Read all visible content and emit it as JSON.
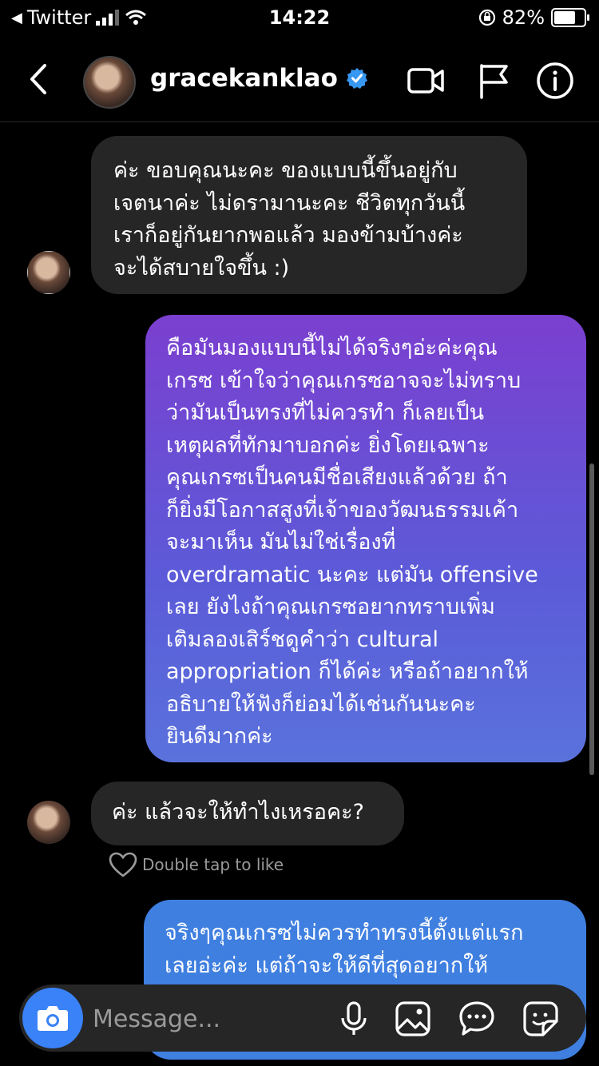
{
  "status_bar": {
    "carrier": "Twitter",
    "time": "14:22",
    "battery_percent": "82%",
    "battery_level": 0.82
  },
  "header": {
    "username": "gracekanklao",
    "verified": true,
    "icons": [
      "back-arrow-icon",
      "video-call-icon",
      "flag-icon",
      "info-icon"
    ]
  },
  "messages": [
    {
      "sender": "them",
      "lines": [
        "ค่ะ ขอบคุณนะคะ ของแบบนี้ขึ้นอยู่กับ",
        "เจตนาค่ะ ไม่ดรามานะคะ ชีวิตทุกวันนี้",
        "เราก็อยู่กันยากพอแล้ว มองข้ามบ้างค่ะ",
        "จะได้สบายใจขึ้น :)"
      ]
    },
    {
      "sender": "me",
      "lines": [
        "คือมันมองแบบนี้ไม่ได้จริงๆอ่ะค่ะคุณ",
        "เกรซ เข้าใจว่าคุณเกรซอาจจะไม่ทราบ",
        "ว่ามันเป็นทรงที่ไม่ควรทำ ก็เลยเป็น",
        "เหตุผลที่ทักมาบอกค่ะ ยิ่งโดยเฉพาะ",
        "คุณเกรซเป็นคนมีชื่อเสียงแล้วด้วย ถ้า",
        "ก็ยิ่งมีโอกาสสูงที่เจ้าของวัฒนธรรมเค้า",
        "จะมาเห็น มันไม่ใช่เรื่องที่",
        "overdramatic นะคะ แต่มัน offensive",
        "เลย ยังไงถ้าคุณเกรซอยากทราบเพิ่ม",
        "เติมลองเสิร์ชดูคำว่า cultural",
        "appropriation ก็ได้ค่ะ หรือถ้าอยากให้",
        "อธิบายให้ฟังก็ย่อมได้เช่นกันนะคะ",
        "ยินดีมากค่ะ"
      ]
    },
    {
      "sender": "them",
      "lines": [
        "ค่ะ แล้วจะให้ทำไงเหรอคะ?"
      ]
    },
    {
      "sender": "me",
      "lines": [
        "จริงๆคุณเกรซไม่ควรทำทรงนี้ตั้งแต่แรก",
        "เลยอ่ะค่ะ แต่ถ้าจะให้ดีที่สุดอยากให้"
      ]
    }
  ],
  "double_tap_hint": "Double tap to like",
  "composer": {
    "placeholder": "Message...",
    "icons": [
      "camera-icon",
      "microphone-icon",
      "gallery-icon",
      "chat-bubble-icon",
      "sticker-icon"
    ]
  },
  "colors": {
    "incoming_bubble": "#262626",
    "outgoing_gradient_top": "#7b3fd0",
    "outgoing_gradient_bottom": "#5a72dc",
    "outgoing_blue": "#3f7fe0",
    "verified_blue": "#3897f0",
    "camera_button": "#3a82f7"
  }
}
